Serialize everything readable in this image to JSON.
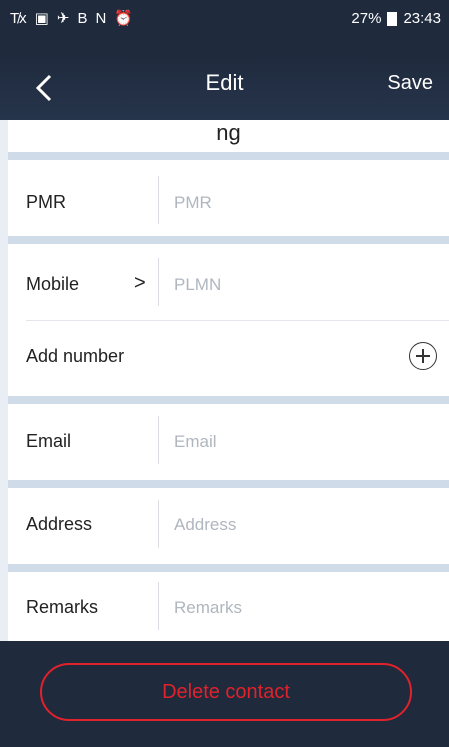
{
  "status": {
    "icons": [
      "T̸x",
      "▣",
      "✈",
      "B",
      "N",
      "⏰"
    ],
    "battery": "27%",
    "time": "23:43"
  },
  "topbar": {
    "back_icon": "chevron-left-icon",
    "title": "Edit",
    "save_label": "Save"
  },
  "name_partial": "ng",
  "fields": {
    "pmr": {
      "label": "PMR",
      "placeholder": "PMR"
    },
    "mobile": {
      "label": "Mobile",
      "arrow": ">",
      "placeholder": "PLMN"
    },
    "add_number": {
      "label": "Add number"
    },
    "email": {
      "label": "Email",
      "placeholder": "Email"
    },
    "address": {
      "label": "Address",
      "placeholder": "Address"
    },
    "remarks": {
      "label": "Remarks",
      "placeholder": "Remarks"
    }
  },
  "actions": {
    "delete_label": "Delete contact"
  },
  "colors": {
    "accent_red": "#e0222b",
    "dark_bg": "#1f2a3d"
  }
}
